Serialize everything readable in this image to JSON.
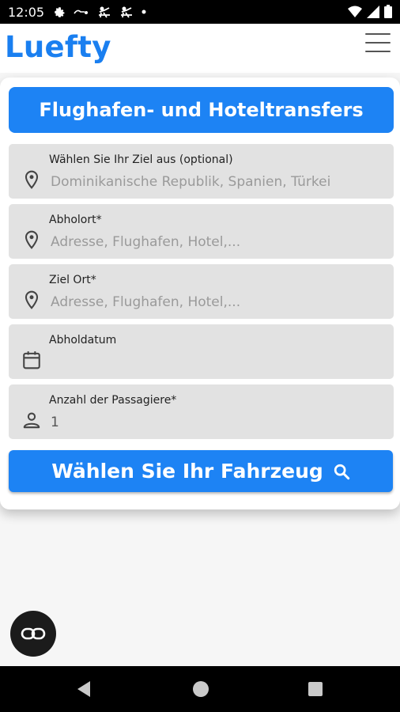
{
  "status_bar": {
    "time": "12:05",
    "icons": [
      "settings-icon",
      "notification-icon",
      "tennis-icon",
      "tennis-icon",
      "dot-icon"
    ],
    "right_icons": [
      "wifi-icon",
      "signal-icon",
      "battery-icon"
    ]
  },
  "app_bar": {
    "logo": "Luefty",
    "menu_icon": "hamburger-menu-icon"
  },
  "banner": {
    "title": "Flughafen- und Hoteltransfers"
  },
  "form": {
    "destination": {
      "label": "Wählen Sie Ihr Ziel aus (optional)",
      "placeholder": "Dominikanische Republik, Spanien, Türkei",
      "icon": "location-pin-icon"
    },
    "pickup": {
      "label": "Abholort*",
      "placeholder": "Adresse, Flughafen, Hotel,...",
      "icon": "location-pin-icon"
    },
    "target": {
      "label": "Ziel Ort*",
      "placeholder": "Adresse, Flughafen, Hotel,...",
      "icon": "location-pin-icon"
    },
    "date": {
      "label": "Abholdatum",
      "value": "",
      "icon": "calendar-icon"
    },
    "passengers": {
      "label": "Anzahl der Passagiere*",
      "value": "1",
      "icon": "person-icon"
    }
  },
  "search_button": {
    "label": "Wählen Sie Ihr Fahrzeug",
    "icon": "search-icon"
  },
  "fab": {
    "icon": "infinity-icon"
  },
  "nav_bar": {
    "icons": [
      "back-icon",
      "home-icon",
      "recents-icon"
    ]
  },
  "colors": {
    "accent": "#1d83f4",
    "logo": "#1a7ff0",
    "field_bg": "#e2e2e2"
  }
}
